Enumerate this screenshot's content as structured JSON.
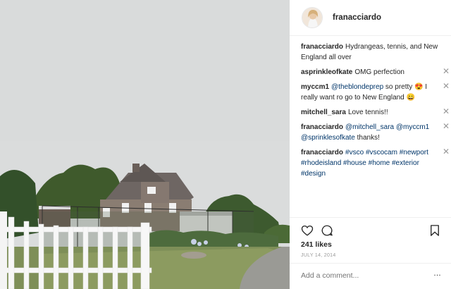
{
  "post": {
    "username": "franacciardo",
    "likes": "241 likes",
    "date": "JULY 14, 2014",
    "add_comment_placeholder": "Add a comment...",
    "more_glyph": "…",
    "close_glyph": "✕",
    "photo_description_icon": "house-photo"
  },
  "comments": [
    {
      "author": "franacciardo",
      "parts": [
        {
          "t": "text",
          "v": "Hydrangeas, tennis, and New England all over"
        }
      ],
      "deletable": false
    },
    {
      "author": "asprinkleofkate",
      "parts": [
        {
          "t": "text",
          "v": "OMG perfection"
        }
      ],
      "deletable": true
    },
    {
      "author": "myccm1",
      "parts": [
        {
          "t": "mention",
          "v": "@theblondeprep"
        },
        {
          "t": "text",
          "v": " so pretty 😍  I really want ro go to New England 😄"
        }
      ],
      "deletable": true
    },
    {
      "author": "mitchell_sara",
      "parts": [
        {
          "t": "text",
          "v": "Love tennis!!"
        }
      ],
      "deletable": true
    },
    {
      "author": "franacciardo",
      "parts": [
        {
          "t": "mention",
          "v": "@mitchell_sara"
        },
        {
          "t": "text",
          "v": " "
        },
        {
          "t": "mention",
          "v": "@myccm1"
        },
        {
          "t": "text",
          "v": " "
        },
        {
          "t": "mention",
          "v": "@sprinklesofkate"
        },
        {
          "t": "text",
          "v": " thanks!"
        }
      ],
      "deletable": true
    },
    {
      "author": "franacciardo",
      "parts": [
        {
          "t": "tag",
          "v": "#vsco"
        },
        {
          "t": "text",
          "v": " "
        },
        {
          "t": "tag",
          "v": "#vscocam"
        },
        {
          "t": "text",
          "v": " "
        },
        {
          "t": "tag",
          "v": "#newport"
        },
        {
          "t": "text",
          "v": " "
        },
        {
          "t": "tag",
          "v": "#rhodeisland"
        },
        {
          "t": "text",
          "v": " "
        },
        {
          "t": "tag",
          "v": "#house"
        },
        {
          "t": "text",
          "v": " "
        },
        {
          "t": "tag",
          "v": "#home"
        },
        {
          "t": "text",
          "v": " "
        },
        {
          "t": "tag",
          "v": "#exterior"
        },
        {
          "t": "text",
          "v": " "
        },
        {
          "t": "tag",
          "v": "#design"
        }
      ],
      "deletable": true
    }
  ],
  "icons": {
    "like": "heart-icon",
    "comment": "comment-bubble-icon",
    "save": "bookmark-icon"
  },
  "colors": {
    "link": "#003569",
    "text": "#262626",
    "muted": "#999999",
    "border": "#efefef"
  }
}
